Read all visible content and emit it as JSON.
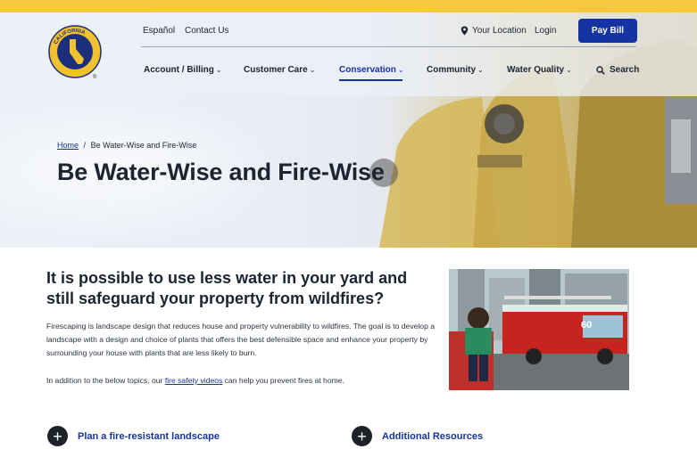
{
  "utility": {
    "espanol": "Español",
    "contact": "Contact Us",
    "location": "Your Location",
    "login": "Login",
    "pay_bill": "Pay Bill"
  },
  "logo": {
    "text_top": "CALIFORNIA",
    "text_bottom": "WATER SERVICE",
    "registered": "®"
  },
  "nav": {
    "account": "Account / Billing",
    "customer_care": "Customer Care",
    "conservation": "Conservation",
    "community": "Community",
    "water_quality": "Water Quality",
    "search": "Search"
  },
  "breadcrumb": {
    "home": "Home",
    "separator": "/",
    "current": "Be Water-Wise and Fire-Wise"
  },
  "page_title": "Be Water-Wise and Fire-Wise",
  "intro": {
    "heading": "It is possible to use less water in your yard and still safeguard your property from wildfires?",
    "paragraph": "Firescaping is landscape design that reduces house and property vulnerability to wildfires. The goal is to develop a landscape with a design and choice of plants that offers the best defensible space and enhance your property by surrounding your house with plants that are less likely to burn.",
    "videos_before": "In addition to the below topics, our",
    "videos_link": "fire safety videos",
    "videos_after": "can help you prevent fires at home."
  },
  "photo": {
    "truck_number": "60"
  },
  "topics": {
    "plan": "Plan a fire-resistant landscape",
    "resources": "Additional Resources"
  },
  "colors": {
    "accent": "#1633a3",
    "stripe": "#f4c93d",
    "brand_gold": "#f2c12e"
  }
}
